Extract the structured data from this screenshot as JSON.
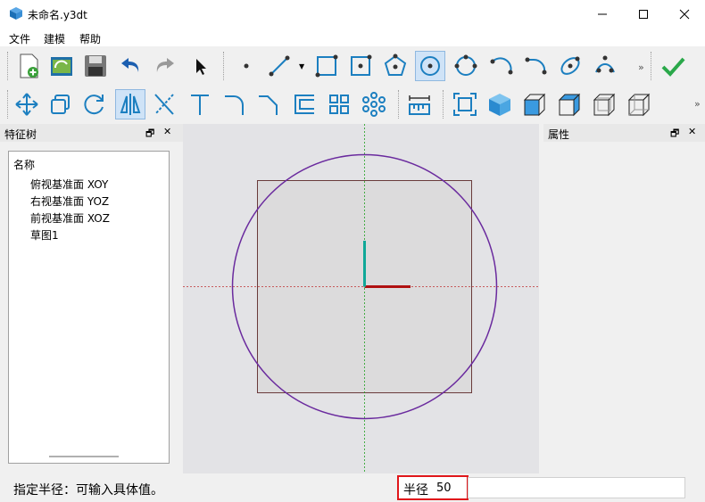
{
  "window": {
    "title": "未命名.y3dt"
  },
  "menu": [
    "文件",
    "建模",
    "帮助"
  ],
  "toolbar_overflow": "»",
  "feature_tree": {
    "title": "特征树",
    "header": "名称",
    "items": [
      "俯视基准面 XOY",
      "右视基准面 YOZ",
      "前视基准面 XOZ",
      "草图1"
    ]
  },
  "properties": {
    "title": "属性"
  },
  "status": {
    "prompt": "指定半径：可输入具体值。",
    "radius_label": "半径",
    "radius_value": "50"
  },
  "colors": {
    "accent": "#0078d4",
    "circle": "#6a2a9e",
    "x_axis": "#b01010",
    "y_axis": "#20b020",
    "z_axis": "#10a898",
    "highlight": "#e0161a"
  }
}
